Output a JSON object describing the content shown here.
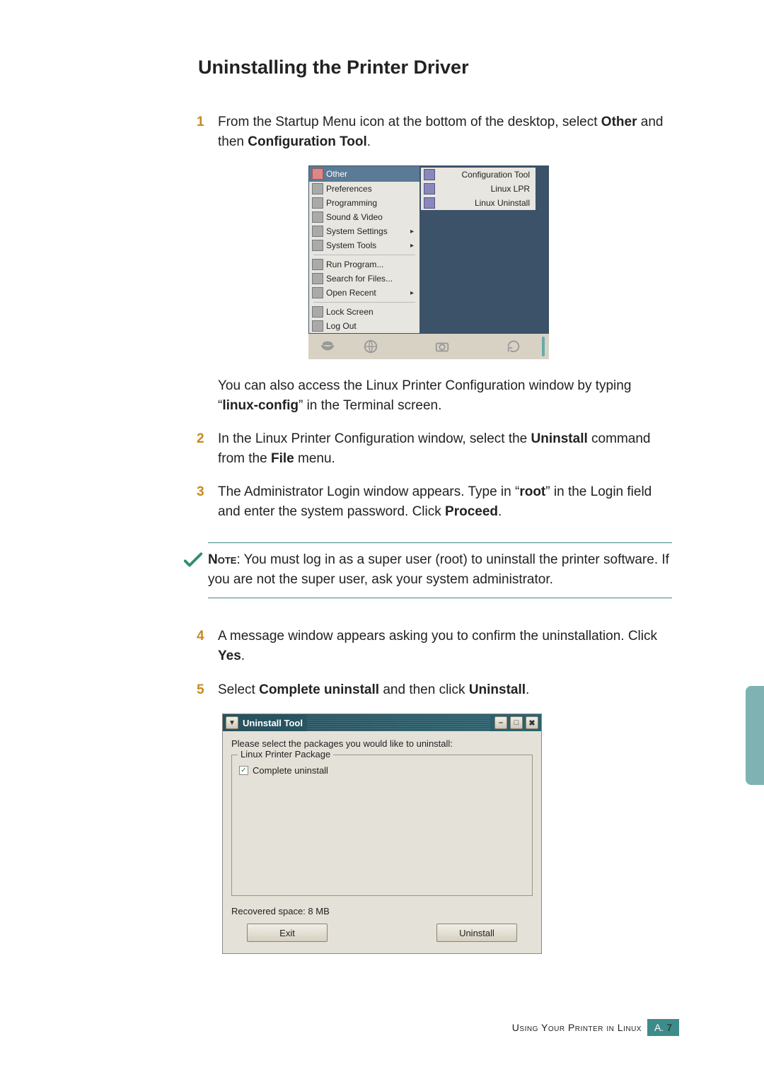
{
  "heading": "Uninstalling the Printer Driver",
  "steps": {
    "s1": {
      "num": "1",
      "text_a": "From the Startup Menu icon at the bottom of the desktop, select ",
      "bold_a": "Other",
      "text_b": " and then ",
      "bold_b": "Configuration Tool",
      "text_c": "."
    },
    "s2": {
      "num": "2",
      "text_a": "In the Linux Printer Configuration window, select the ",
      "bold_a": "Uninstall",
      "text_b": " command from the ",
      "bold_b": "File",
      "text_c": " menu."
    },
    "s3": {
      "num": "3",
      "text_a": "The Administrator Login window appears. Type in “",
      "bold_a": "root",
      "text_b": "” in the Login field and enter the system password. Click ",
      "bold_b": "Proceed",
      "text_c": "."
    },
    "s4": {
      "num": "4",
      "text_a": "A message window appears asking you to confirm the uninstallation. Click ",
      "bold_a": "Yes",
      "text_b": "."
    },
    "s5": {
      "num": "5",
      "text_a": "Select ",
      "bold_a": "Complete uninstall",
      "text_b": " and then click ",
      "bold_b": "Uninstall",
      "text_c": "."
    }
  },
  "continuation": {
    "text_a": "You can also access the Linux Printer Configuration window by typing “",
    "bold_a": "linux-config",
    "text_b": "” in the Terminal screen."
  },
  "note": {
    "label": "Note",
    "text": ": You must log in as a super user (root) to uninstall the printer software. If you are not the super user, ask your system administrator."
  },
  "linux_menu": {
    "header": "Other",
    "items1": [
      "Preferences",
      "Programming",
      "Sound & Video",
      "System Settings",
      "System Tools"
    ],
    "items2": [
      "Run Program...",
      "Search for Files...",
      "Open Recent"
    ],
    "items3": [
      "Lock Screen",
      "Log Out"
    ],
    "arrows1": [
      "",
      "",
      "",
      "▸",
      "▸"
    ],
    "arrows2": [
      "",
      "",
      "▸"
    ],
    "submenu": [
      "Configuration Tool",
      "Linux LPR",
      "Linux Uninstall"
    ]
  },
  "uninstall_dialog": {
    "title": "Uninstall Tool",
    "prompt": "Please select the packages you would like to uninstall:",
    "pkg_legend": "Linux Printer Package",
    "checkbox_label": "Complete uninstall",
    "checkbox_checked": "✓",
    "recovered": "Recovered space:  8 MB",
    "exit_btn": "Exit",
    "uninstall_btn": "Uninstall",
    "min_glyph": "–",
    "max_glyph": "□",
    "close_glyph": "✖",
    "down_glyph": "▼"
  },
  "footer": {
    "text": "Using Your Printer in Linux",
    "pg_a": "A.",
    "pg_num": "7"
  }
}
